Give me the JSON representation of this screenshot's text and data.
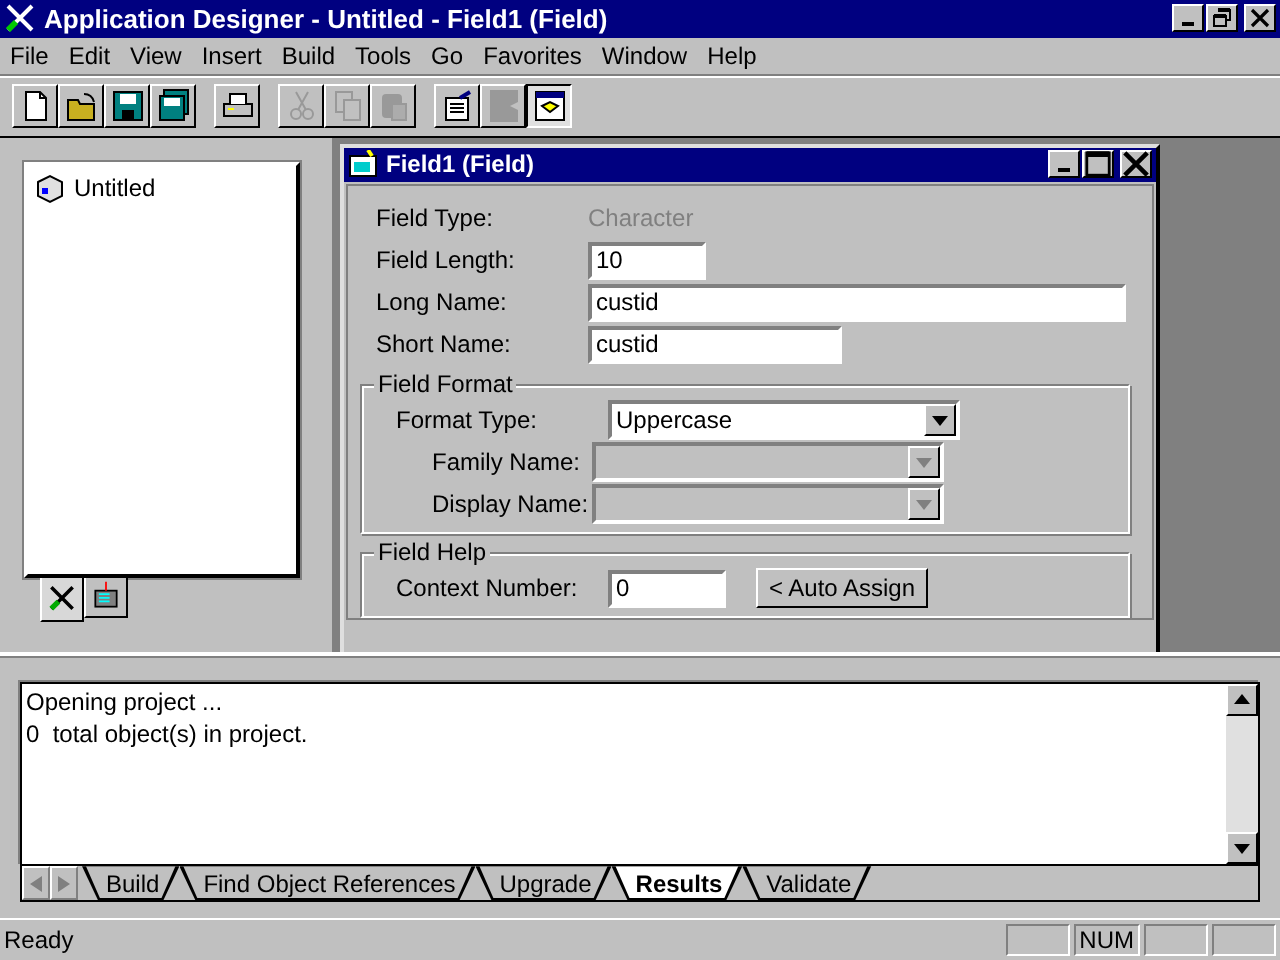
{
  "window": {
    "title": "Application Designer - Untitled - Field1 (Field)"
  },
  "menu": [
    {
      "label": "File"
    },
    {
      "label": "Edit"
    },
    {
      "label": "View"
    },
    {
      "label": "Insert"
    },
    {
      "label": "Build"
    },
    {
      "label": "Tools"
    },
    {
      "label": "Go"
    },
    {
      "label": "Favorites"
    },
    {
      "label": "Window"
    },
    {
      "label": "Help"
    }
  ],
  "toolbar": [
    {
      "kind": "new",
      "disabled": false,
      "pressed": false
    },
    {
      "kind": "open",
      "disabled": false,
      "pressed": false
    },
    {
      "kind": "save",
      "disabled": false,
      "pressed": false
    },
    {
      "kind": "save-all",
      "disabled": false,
      "pressed": false
    },
    {
      "kind": "sep"
    },
    {
      "kind": "print",
      "disabled": false,
      "pressed": false
    },
    {
      "kind": "sep"
    },
    {
      "kind": "cut",
      "disabled": true,
      "pressed": false
    },
    {
      "kind": "copy",
      "disabled": true,
      "pressed": false
    },
    {
      "kind": "paste",
      "disabled": true,
      "pressed": false
    },
    {
      "kind": "sep"
    },
    {
      "kind": "properties",
      "disabled": false,
      "pressed": false
    },
    {
      "kind": "object",
      "disabled": true,
      "pressed": false
    },
    {
      "kind": "workspace",
      "disabled": false,
      "pressed": true
    }
  ],
  "project_tree": {
    "items": [
      {
        "label": "Untitled"
      }
    ],
    "tabs": [
      {
        "kind": "development",
        "selected": true
      },
      {
        "kind": "upgrade",
        "selected": false
      }
    ]
  },
  "field_window": {
    "title": "Field1 (Field)",
    "rows": [
      {
        "kind": "static",
        "label": "Field Type:",
        "value": "Character",
        "disabled": true
      },
      {
        "kind": "input",
        "label": "Field Length:",
        "value": "10"
      },
      {
        "kind": "input",
        "label": "Long Name:",
        "value": "custid"
      },
      {
        "kind": "input",
        "label": "Short Name:",
        "value": "custid"
      }
    ],
    "groups": [
      {
        "title": "Field Format",
        "rows": [
          {
            "kind": "combo",
            "label": "Format Type:",
            "value": "Uppercase",
            "disabled": false,
            "indented": false
          },
          {
            "kind": "combo",
            "label": "Family Name:",
            "disabled": true,
            "indented": true
          },
          {
            "kind": "combo",
            "label": "Display Name:",
            "disabled": true,
            "indented": true
          }
        ]
      },
      {
        "title": "Field Help",
        "rows": [
          {
            "kind": "input-button",
            "label": "Context Number:",
            "value": "0",
            "button": "< Auto Assign"
          }
        ]
      }
    ]
  },
  "output": {
    "lines": [
      "Opening project ...",
      "0  total object(s) in project."
    ],
    "tabs": [
      {
        "label": "Build",
        "selected": false
      },
      {
        "label": "Find Object References",
        "selected": false
      },
      {
        "label": "Upgrade",
        "selected": false
      },
      {
        "label": "Results",
        "selected": true
      },
      {
        "label": "Validate",
        "selected": false
      }
    ]
  },
  "status_bar": {
    "text": "Ready",
    "indicators": [
      "NUM"
    ]
  }
}
